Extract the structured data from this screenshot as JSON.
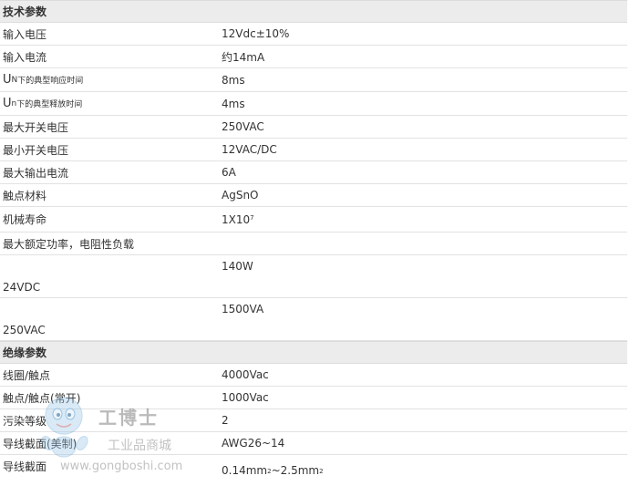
{
  "section1": {
    "title": "技术参数",
    "rows": [
      {
        "label": "输入电压",
        "value": "12Vdc±10%"
      },
      {
        "label": "输入电流",
        "value": "约14mA"
      },
      {
        "label_big": "U",
        "label_sub": "N",
        "label_small": "下的典型响应时间",
        "value": "8ms"
      },
      {
        "label_big": "U",
        "label_sub": "n",
        "label_small": "下的典型释放时间",
        "value": "4ms"
      },
      {
        "label": "最大开关电压",
        "value": "250VAC"
      },
      {
        "label": "最小开关电压",
        "value": "12VAC/DC"
      },
      {
        "label": "最大输出电流",
        "value": "6A"
      },
      {
        "label": "触点材料",
        "value": "AgSnO"
      },
      {
        "label": "机械寿命",
        "value_base": "1X10",
        "value_exp": "7"
      },
      {
        "label": "最大额定功率，电阻性负载",
        "value": ""
      }
    ],
    "power": [
      {
        "value": "140W",
        "label": "24VDC"
      },
      {
        "value": "1500VA",
        "label": "250VAC"
      }
    ]
  },
  "section2": {
    "title": "绝缘参数",
    "rows": [
      {
        "label": "线圈/触点",
        "value": "4000Vac"
      },
      {
        "label": "触点/触点(常开)",
        "value": "1000Vac"
      },
      {
        "label": "污染等级",
        "value": "2"
      },
      {
        "label": "导线截面(美制)",
        "value": "AWG26~14"
      },
      {
        "label": "导线截面",
        "value_a": "0.14mm",
        "exp_a": "2",
        "value_mid": "~2.5mm",
        "exp_b": "2"
      }
    ]
  },
  "watermark": {
    "brand": "工博士",
    "subtitle": "工业品商城",
    "url": "www.gongboshi.com"
  }
}
